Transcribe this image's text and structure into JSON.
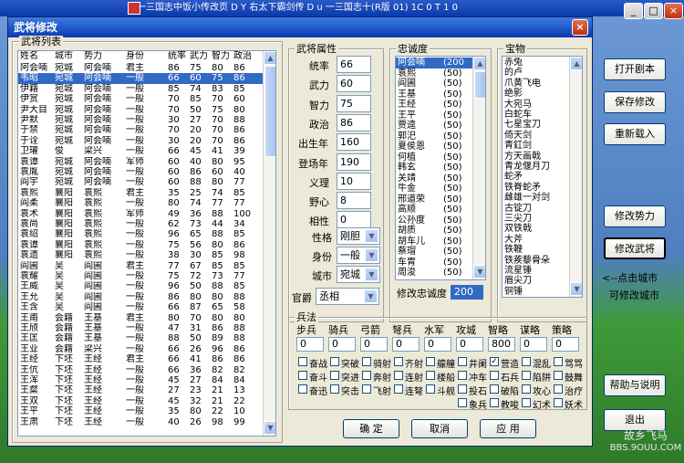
{
  "background": {
    "title": "一三国志中饭小传改页 D  Y  右太下霸剑传  D  u  一三国志十(R版   01) 1C  0 T 1 0",
    "min": "_",
    "max": "□",
    "close": "×"
  },
  "window": {
    "title": "武将修改",
    "close": "×"
  },
  "list": {
    "label": "武将列表",
    "headers": [
      "姓名",
      "城市",
      "势力",
      "身份",
      "统率",
      "武力",
      "智力",
      "政治"
    ],
    "rows": [
      [
        "阿会喃",
        "宛城",
        "阿会喃",
        "君主",
        "86",
        "75",
        "80",
        "86"
      ],
      [
        "韦昭",
        "宛城",
        "阿会喃",
        "一般",
        "66",
        "60",
        "75",
        "86"
      ],
      [
        "伊籍",
        "宛城",
        "阿会喃",
        "一般",
        "85",
        "74",
        "83",
        "85"
      ],
      [
        "伊赏",
        "宛城",
        "阿会喃",
        "一般",
        "70",
        "85",
        "70",
        "60"
      ],
      [
        "尹大目",
        "宛城",
        "阿会喃",
        "一般",
        "70",
        "50",
        "75",
        "80"
      ],
      [
        "尹默",
        "宛城",
        "阿会喃",
        "一般",
        "30",
        "27",
        "70",
        "88"
      ],
      [
        "于禁",
        "宛城",
        "阿会喃",
        "一般",
        "70",
        "20",
        "70",
        "86"
      ],
      [
        "于诠",
        "宛城",
        "阿会喃",
        "一般",
        "30",
        "20",
        "70",
        "86"
      ],
      [
        "卫瓘",
        "俊",
        "梁兴",
        "一般",
        "66",
        "45",
        "41",
        "39"
      ],
      [
        "袁谭",
        "宛城",
        "阿会喃",
        "军师",
        "60",
        "40",
        "80",
        "95"
      ],
      [
        "袁胤",
        "宛城",
        "阿会喃",
        "一般",
        "60",
        "86",
        "60",
        "40"
      ],
      [
        "阎宇",
        "宛城",
        "阿会喃",
        "一般",
        "60",
        "88",
        "80",
        "77"
      ],
      [
        "袁熙",
        "襄阳",
        "袁熙",
        "君主",
        "35",
        "25",
        "74",
        "85"
      ],
      [
        "阎柔",
        "襄阳",
        "袁熙",
        "一般",
        "80",
        "74",
        "77",
        "77"
      ],
      [
        "袁术",
        "襄阳",
        "袁熙",
        "军师",
        "49",
        "36",
        "88",
        "100"
      ],
      [
        "袁尚",
        "襄阳",
        "袁熙",
        "一般",
        "62",
        "73",
        "44",
        "34"
      ],
      [
        "袁绍",
        "襄阳",
        "袁熙",
        "一般",
        "96",
        "65",
        "88",
        "85"
      ],
      [
        "袁谭",
        "襄阳",
        "袁熙",
        "一般",
        "75",
        "56",
        "80",
        "86"
      ],
      [
        "袁遗",
        "襄阳",
        "袁熙",
        "一般",
        "38",
        "30",
        "85",
        "98"
      ],
      [
        "阎圃",
        "吴",
        "阎圃",
        "君主",
        "77",
        "67",
        "85",
        "85"
      ],
      [
        "袁耀",
        "吴",
        "阎圃",
        "一般",
        "75",
        "72",
        "73",
        "77"
      ],
      [
        "王威",
        "吴",
        "阎圃",
        "一般",
        "96",
        "50",
        "88",
        "85"
      ],
      [
        "王允",
        "吴",
        "阎圃",
        "一般",
        "86",
        "80",
        "80",
        "88"
      ],
      [
        "王含",
        "吴",
        "阎圃",
        "一般",
        "66",
        "87",
        "65",
        "58"
      ],
      [
        "王甫",
        "会籍",
        "王基",
        "君主",
        "80",
        "70",
        "80",
        "80"
      ],
      [
        "王颀",
        "会籍",
        "王基",
        "一般",
        "47",
        "31",
        "86",
        "88"
      ],
      [
        "王匡",
        "会籍",
        "王基",
        "一般",
        "88",
        "50",
        "89",
        "88"
      ],
      [
        "王业",
        "会籍",
        "梁兴",
        "一般",
        "66",
        "26",
        "96",
        "86"
      ],
      [
        "王经",
        "下坯",
        "王经",
        "君主",
        "66",
        "41",
        "86",
        "86"
      ],
      [
        "王伉",
        "下坯",
        "王经",
        "一般",
        "66",
        "36",
        "82",
        "82"
      ],
      [
        "王浑",
        "下坯",
        "王经",
        "一般",
        "45",
        "27",
        "84",
        "84"
      ],
      [
        "王粲",
        "下坯",
        "王经",
        "一般",
        "27",
        "23",
        "21",
        "13"
      ],
      [
        "王双",
        "下坯",
        "王经",
        "一般",
        "45",
        "32",
        "21",
        "22"
      ],
      [
        "王平",
        "下坯",
        "王经",
        "一般",
        "35",
        "80",
        "22",
        "10"
      ],
      [
        "王肃",
        "下坯",
        "王经",
        "一般",
        "40",
        "26",
        "98",
        "99"
      ]
    ]
  },
  "attrs": {
    "label": "武将属性",
    "fields": [
      {
        "label": "统率",
        "value": "66"
      },
      {
        "label": "武力",
        "value": "60"
      },
      {
        "label": "智力",
        "value": "75"
      },
      {
        "label": "政治",
        "value": "86"
      },
      {
        "label": "出生年",
        "value": "160"
      },
      {
        "label": "登场年",
        "value": "190"
      },
      {
        "label": "义理",
        "value": "10"
      },
      {
        "label": "野心",
        "value": "8"
      },
      {
        "label": "相性",
        "value": "0"
      }
    ],
    "personality": {
      "label": "性格",
      "value": "刚胆"
    },
    "rank": {
      "label": "身份",
      "value": "一般"
    },
    "city": {
      "label": "城市",
      "value": "宛城"
    },
    "title": {
      "label": "官爵",
      "value": "丞相"
    }
  },
  "loyalty": {
    "label": "忠诚度",
    "items": [
      [
        "阿会喃",
        "(200"
      ],
      [
        "袁熙",
        "(50)"
      ],
      [
        "阎圃",
        "(50)"
      ],
      [
        "王基",
        "(50)"
      ],
      [
        "王经",
        "(50)"
      ],
      [
        "王平",
        "(50)"
      ],
      [
        "贾逵",
        "(50)"
      ],
      [
        "郭汜",
        "(50)"
      ],
      [
        "夏侯恩",
        "(50)"
      ],
      [
        "何植",
        "(50)"
      ],
      [
        "韩玄",
        "(50)"
      ],
      [
        "关靖",
        "(50)"
      ],
      [
        "牛金",
        "(50)"
      ],
      [
        "邢道荣",
        "(50)"
      ],
      [
        "高顺",
        "(50)"
      ],
      [
        "公孙度",
        "(50)"
      ],
      [
        "胡质",
        "(50)"
      ],
      [
        "胡车儿",
        "(50)"
      ],
      [
        "蔡瑁",
        "(50)"
      ],
      [
        "车胄",
        "(50)"
      ],
      [
        "周浚",
        "(50)"
      ]
    ],
    "edit_label": "修改忠诚度",
    "edit_value": "200"
  },
  "treasure": {
    "label": "宝物",
    "items": [
      "赤兔",
      "的卢",
      "爪黄飞电",
      "绝影",
      "大宛马",
      "白蛇车",
      "七星宝刀",
      "倚天剑",
      "青釭剑",
      "方天画戟",
      "青龙偃月刀",
      "蛇矛",
      "铁脊蛇矛",
      "雌雄一对剑",
      "古锭刀",
      "三尖刀",
      "双铁戟",
      "大斧",
      "铁鞭",
      "铁蒺藜骨朵",
      "流星锤",
      "眉尖刀",
      "铜锤"
    ]
  },
  "troops": {
    "label": "兵法",
    "headers": [
      "步兵",
      "骑兵",
      "弓箭",
      "弩兵",
      "水军",
      "攻城",
      "智略",
      "谋略",
      "策略"
    ],
    "values": [
      "0",
      "0",
      "0",
      "0",
      "0",
      "0",
      "800",
      "0",
      "0"
    ],
    "skills": [
      [
        [
          "奋战",
          false
        ],
        [
          "突破",
          false
        ],
        [
          "骑射",
          false
        ],
        [
          "齐射",
          false
        ],
        [
          "艨艟",
          false
        ],
        [
          "井阑",
          false
        ],
        [
          "营造",
          true
        ],
        [
          "混乱",
          false
        ],
        [
          "骂骂",
          false
        ]
      ],
      [
        [
          "奋斗",
          false
        ],
        [
          "突进",
          false
        ],
        [
          "奔射",
          false
        ],
        [
          "连射",
          false
        ],
        [
          "楼船",
          false
        ],
        [
          "冲车",
          false
        ],
        [
          "石兵",
          false
        ],
        [
          "陷阱",
          false
        ],
        [
          "鼓舞",
          false
        ]
      ],
      [
        [
          "奋迅",
          false
        ],
        [
          "突击",
          false
        ],
        [
          "飞射",
          false
        ],
        [
          "连弩",
          false
        ],
        [
          "斗舰",
          false
        ],
        [
          "投石",
          false
        ],
        [
          "破陷",
          false
        ],
        [
          "攻心",
          false
        ],
        [
          "治疗",
          false
        ]
      ],
      [
        [
          "",
          false
        ],
        [
          "",
          false
        ],
        [
          "",
          false
        ],
        [
          "",
          false
        ],
        [
          "",
          false
        ],
        [
          "象兵",
          false
        ],
        [
          "教唆",
          false
        ],
        [
          "幻术",
          false
        ],
        [
          "妖术",
          false
        ]
      ]
    ]
  },
  "buttons": {
    "ok": "确 定",
    "cancel": "取消",
    "apply": "应 用"
  },
  "side": {
    "open": "打开剧本",
    "save": "保存修改",
    "reload": "重新载入",
    "modforce": "修改势力",
    "modgeneral": "修改武将",
    "hint1": "<--点击城市",
    "hint2": "可修改城市",
    "help": "帮助与说明",
    "exit": "退出"
  },
  "watermark": {
    "line1": "故乡飞马",
    "line2": "BBS.9OUU.COM"
  }
}
